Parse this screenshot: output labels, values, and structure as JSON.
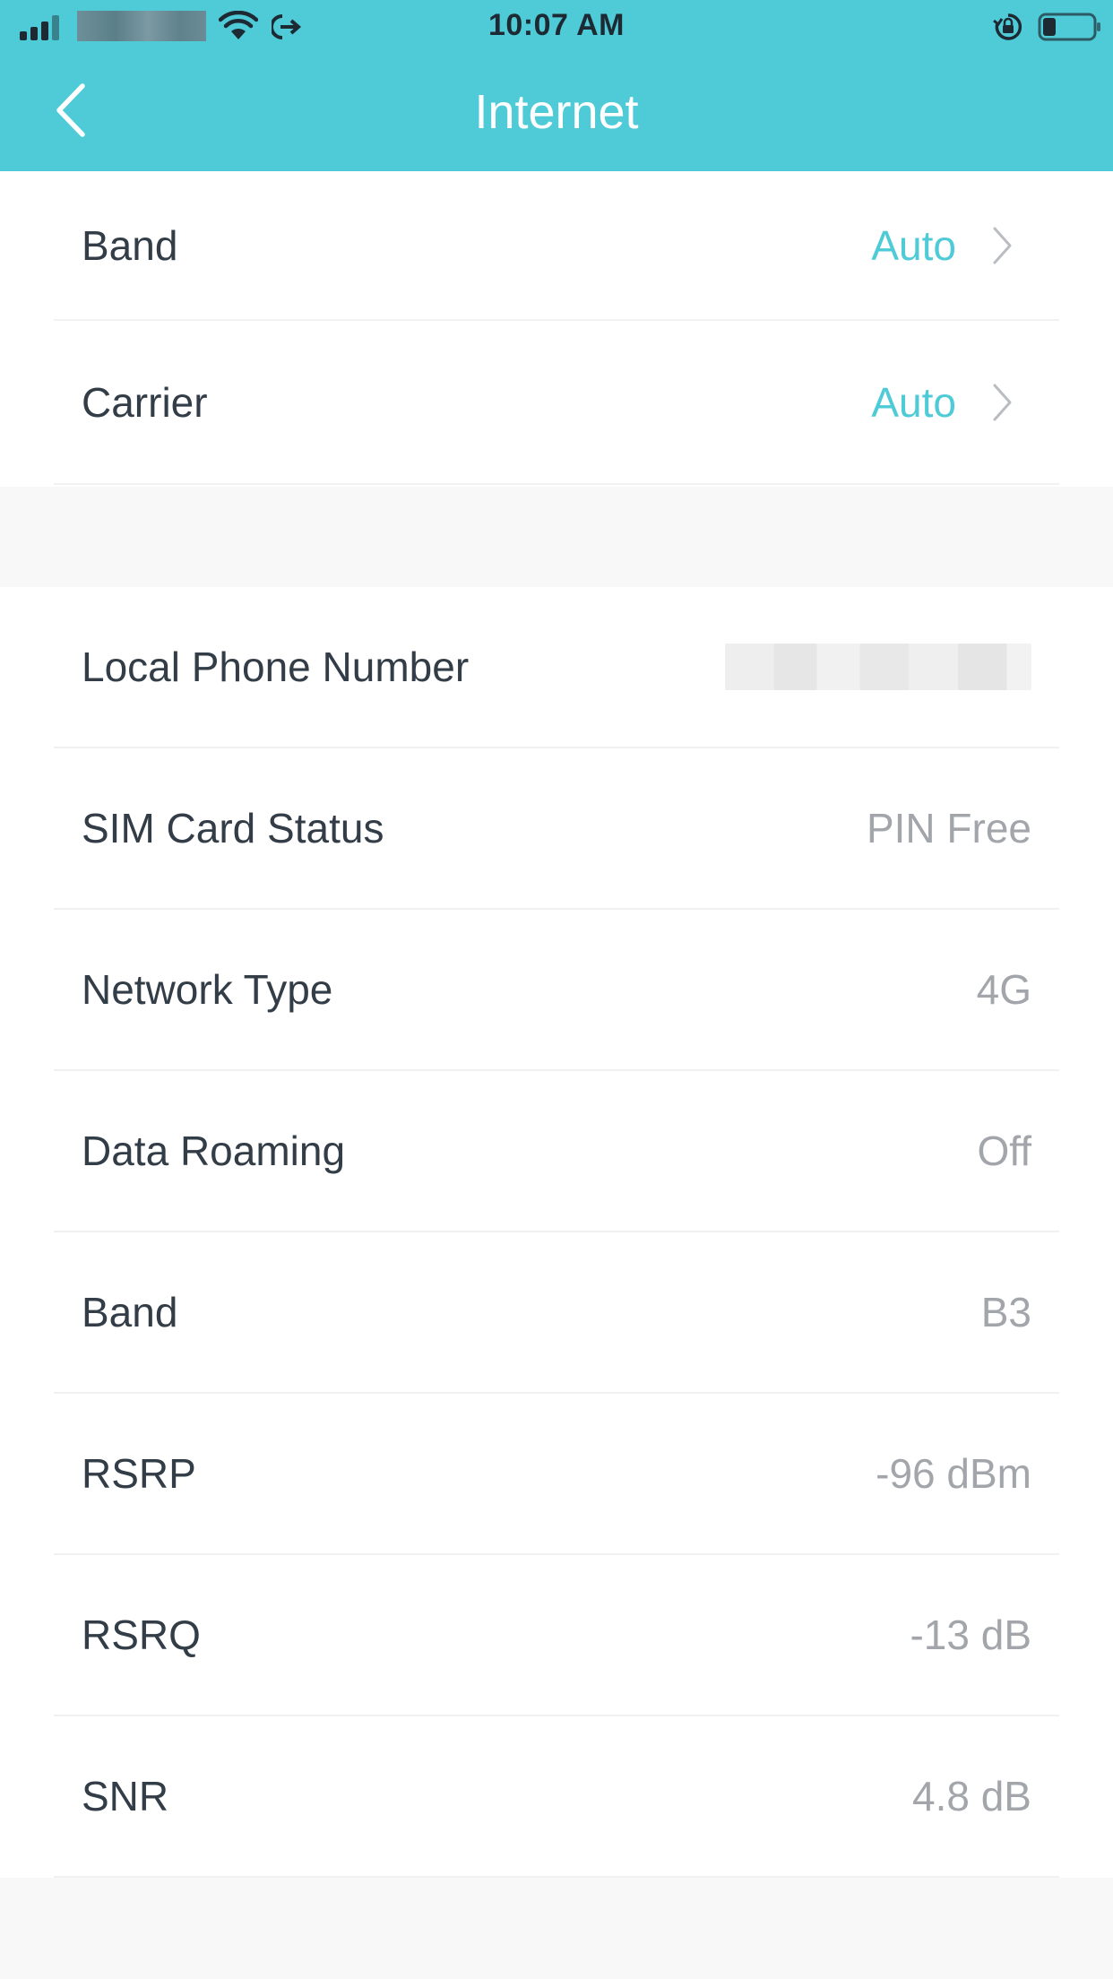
{
  "status_bar": {
    "time": "10:07 AM"
  },
  "navbar": {
    "title": "Internet",
    "back_icon": "chevron-left-icon"
  },
  "settings": [
    {
      "label": "Band",
      "value": "Auto"
    },
    {
      "label": "Carrier",
      "value": "Auto"
    }
  ],
  "info": [
    {
      "label": "Local Phone Number",
      "value": ""
    },
    {
      "label": "SIM Card Status",
      "value": "PIN Free"
    },
    {
      "label": "Network Type",
      "value": "4G"
    },
    {
      "label": "Data Roaming",
      "value": "Off"
    },
    {
      "label": "Band",
      "value": "B3"
    },
    {
      "label": "RSRP",
      "value": "-96 dBm"
    },
    {
      "label": "RSRQ",
      "value": "-13 dB"
    },
    {
      "label": "SNR",
      "value": "4.8 dB"
    }
  ],
  "colors": {
    "accent": "#4ecbd7",
    "label": "#333d47",
    "value": "#a2a6ab",
    "background": "#f8f8f8"
  }
}
